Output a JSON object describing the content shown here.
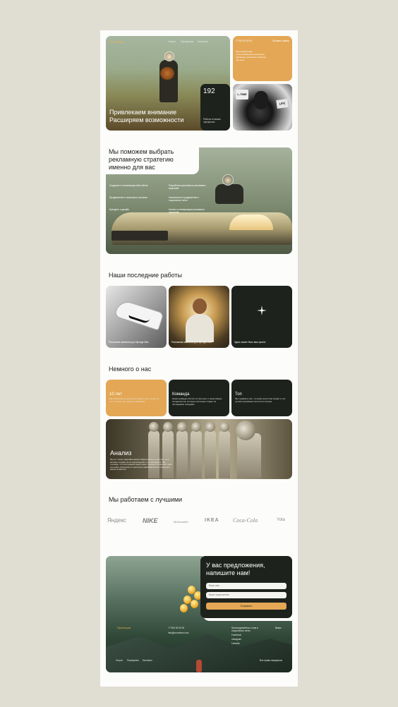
{
  "hero": {
    "logo": "Промоция",
    "nav": [
      "Услуги",
      "Портфолио",
      "Контакты"
    ],
    "title_line1": "Привлекаем внимание",
    "title_line2": "Расширяем возможности"
  },
  "contact": {
    "phone": "+7 900 00 00 00",
    "cta": "Оставить заявку",
    "desc": "Мы разработаем интегрированную рекламную кампанию для вашего бизнеса под ключ"
  },
  "stats": {
    "count": "192",
    "label": "Работы в нашем портфолио"
  },
  "strategy": {
    "title_line1": "Мы поможем выбрать",
    "title_line2": "рекламную стратегию",
    "title_line3": "именно для вас",
    "services": [
      "Создание и оптимизация веб-сайтов",
      "Разработка креативных рекламных кампаний",
      "Продвижение в поисковых системах",
      "Комплексное продвижение в социальных сетях",
      "Брендинг и дизайн",
      "Анализ и оптимизация рекламных кампаний"
    ]
  },
  "works": {
    "title": "Наши последние работы",
    "items": [
      {
        "caption": "Рекламная кампания для бренда Nike"
      },
      {
        "caption": "Рекламная кампания для бренда Love"
      },
      {
        "caption": "Здесь может быть ваш проект"
      }
    ]
  },
  "about": {
    "title": "Немного о нас",
    "cards": [
      {
        "title": "10 лет",
        "desc": "Мы работаем на рынке рекламных услуг более 10 лет и знаем, как привлечь внимание"
      },
      {
        "title": "Команда",
        "desc": "Наша команда состоит из опытных и талантливых специалистов, которые постоянно следят за последними трендами"
      },
      {
        "title": "Топ",
        "desc": "Мы гордимся тем, что наше агентство входит в топ лучших рекламных агентств в стране"
      }
    ],
    "analysis": {
      "title": "Анализ",
      "desc": "Мы не только разрабатываем эффективные стратегии, но и активно следим за их реализацией и оптимизацией. Мы считаем, что постоянный мониторинг и анализ позволяют нам улучшать результаты и достигать максимального успеха для наших клиентов"
    }
  },
  "partners": {
    "title": "Мы работаем с лучшими",
    "logos": [
      "Яндекс",
      "NIKE",
      "McDonald's",
      "IKEA",
      "Coca-Cola",
      "Yota"
    ]
  },
  "form": {
    "title_line1": "У вас предложения,",
    "title_line2": "напишите нам!",
    "name_placeholder": "Ваше имя",
    "message_placeholder": "Ваше предложение",
    "submit": "Отправить"
  },
  "footer": {
    "logo": "Промоция",
    "phone": "+7 900 00 00 00",
    "email": "info@promotion.com",
    "social_heading": "Присоединяйтесь к нам в социальных сетях",
    "social": [
      "Facebook",
      "Instagram",
      "LinkedIn"
    ],
    "back_to_top": "Вверх",
    "nav": [
      "Услуги",
      "Портфолио",
      "Контакты"
    ],
    "rights": "Все права защищены"
  },
  "colors": {
    "accent": "#e3a755",
    "dark": "#1d221d",
    "page": "#fcfcfb",
    "backdrop": "#e0ddd3"
  }
}
